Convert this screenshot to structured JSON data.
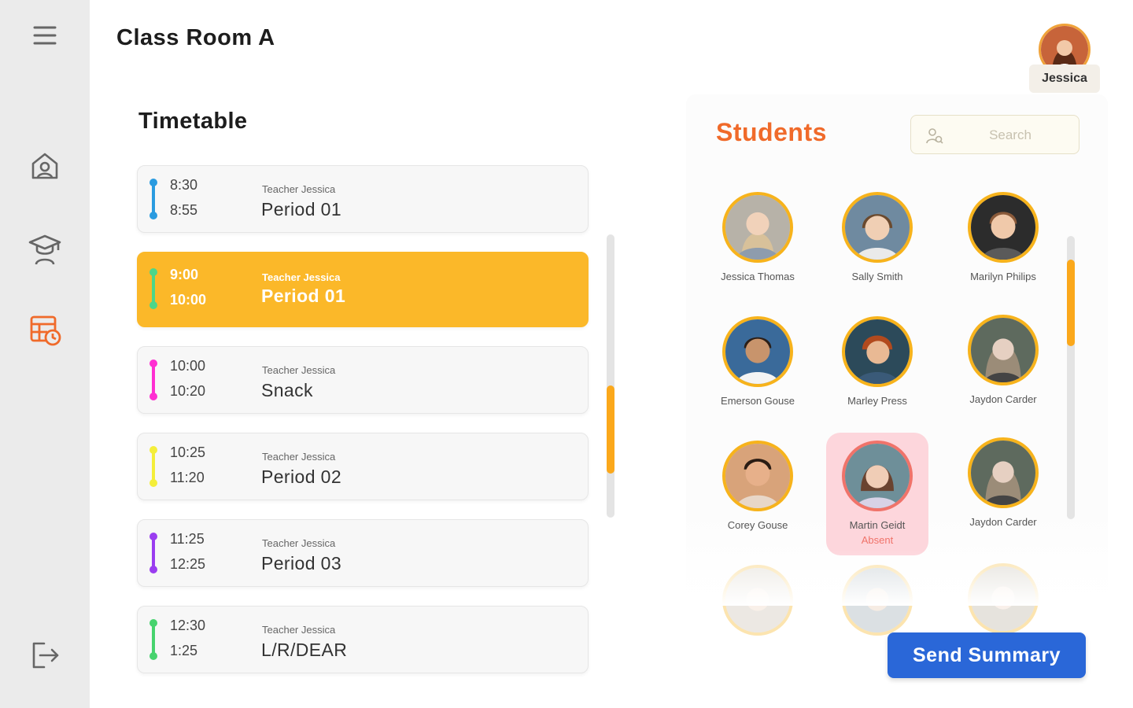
{
  "header": {
    "title": "Class Room A",
    "user_name": "Jessica"
  },
  "sidebar": {
    "items": [
      {
        "icon": "menu-icon"
      },
      {
        "icon": "school-icon"
      },
      {
        "icon": "teacher-icon"
      },
      {
        "icon": "timetable-icon",
        "active": true
      },
      {
        "icon": "logout-icon"
      }
    ]
  },
  "timetable": {
    "title": "Timetable",
    "periods": [
      {
        "start": "8:30",
        "end": "8:55",
        "teacher": "Teacher Jessica",
        "name": "Period 01",
        "color": "#2a9be0"
      },
      {
        "start": "9:00",
        "end": "10:00",
        "teacher": "Teacher Jessica",
        "name": "Period 01",
        "color": "#4bd68a",
        "active": true
      },
      {
        "start": "10:00",
        "end": "10:20",
        "teacher": "Teacher Jessica",
        "name": "Snack",
        "color": "#ff2fd2"
      },
      {
        "start": "10:25",
        "end": "11:20",
        "teacher": "Teacher Jessica",
        "name": "Period 02",
        "color": "#f4ee3a"
      },
      {
        "start": "11:25",
        "end": "12:25",
        "teacher": "Teacher Jessica",
        "name": "Period 03",
        "color": "#9a3df0"
      },
      {
        "start": "12:30",
        "end": "1:25",
        "teacher": "Teacher Jessica",
        "name": "L/R/DEAR",
        "color": "#47d36e"
      }
    ]
  },
  "students": {
    "title": "Students",
    "search_placeholder": "Search",
    "list": [
      {
        "name": "Jessica Thomas",
        "status": ""
      },
      {
        "name": "Sally Smith",
        "status": ""
      },
      {
        "name": "Marilyn Philips",
        "status": ""
      },
      {
        "name": "Emerson Gouse",
        "status": ""
      },
      {
        "name": "Marley Press",
        "status": ""
      },
      {
        "name": "Jaydon Carder",
        "status": ""
      },
      {
        "name": "Corey Gouse",
        "status": ""
      },
      {
        "name": "Martin Geidt",
        "status": "Absent"
      },
      {
        "name": "Jaydon Carder",
        "status": ""
      }
    ]
  },
  "actions": {
    "send_summary": "Send Summary"
  },
  "colors": {
    "accent_orange": "#fbb829",
    "students_title": "#f06a2a",
    "primary_blue": "#2a67d8",
    "absent_bg": "#fdd6dc"
  }
}
